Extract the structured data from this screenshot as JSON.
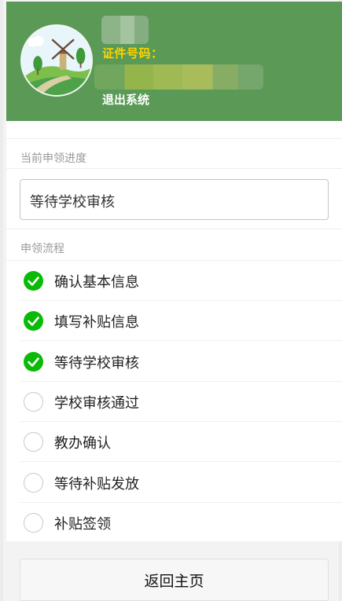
{
  "header": {
    "id_label": "证件号码：",
    "logout_label": "退出系统"
  },
  "progress": {
    "section_title": "当前申领进度",
    "current_status": "等待学校审核"
  },
  "flow": {
    "section_title": "申领流程",
    "steps": [
      {
        "label": "确认基本信息",
        "done": true
      },
      {
        "label": "填写补贴信息",
        "done": true
      },
      {
        "label": "等待学校审核",
        "done": true
      },
      {
        "label": "学校审核通过",
        "done": false
      },
      {
        "label": "教办确认",
        "done": false
      },
      {
        "label": "等待补贴发放",
        "done": false
      },
      {
        "label": "补贴签领",
        "done": false
      }
    ]
  },
  "footer": {
    "home_label": "返回主页"
  },
  "colors": {
    "header_bg": "#5a9a56",
    "id_label": "#ffd400",
    "done_check": "#09bb07"
  },
  "icons": {
    "done": "check-circle-icon",
    "todo": "empty-circle-icon"
  }
}
